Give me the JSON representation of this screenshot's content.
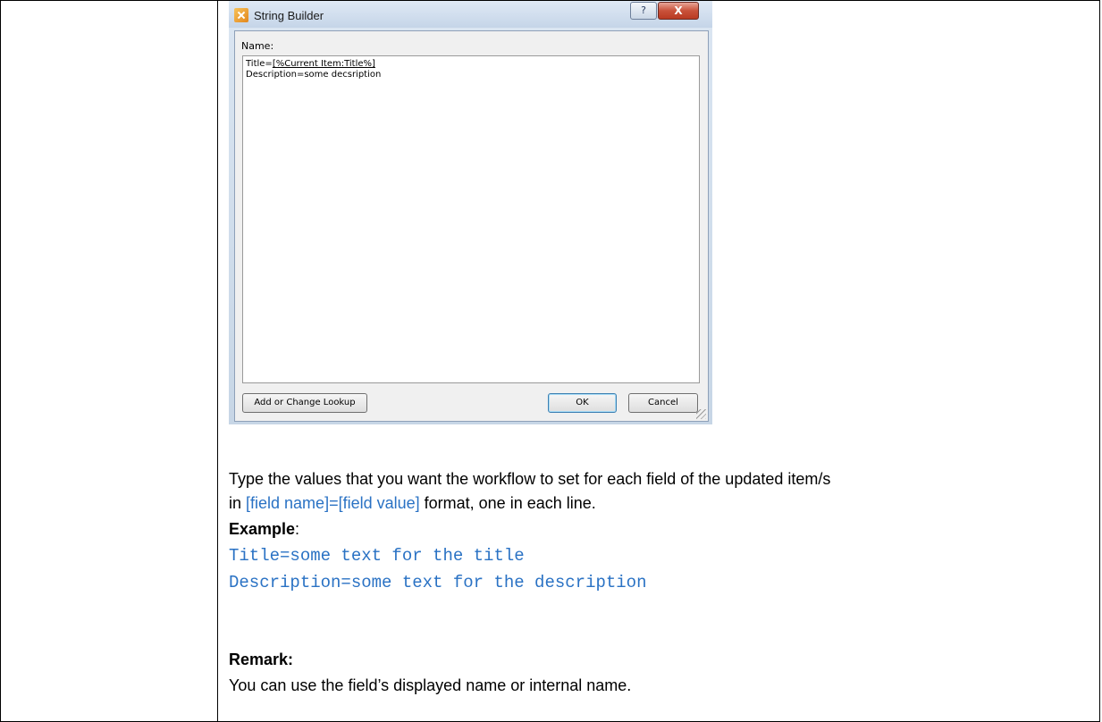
{
  "dialog": {
    "title": "String Builder",
    "help_glyph": "?",
    "close_glyph": "X",
    "name_label": "Name:",
    "editor_line1_prefix": "Title=",
    "editor_line1_lookup": "[%Current Item:Title%]",
    "editor_line2": "Description=some decsription",
    "add_lookup_label": "Add or Change Lookup",
    "ok_label": "OK",
    "cancel_label": "Cancel"
  },
  "body": {
    "para1": "Type the values that you want the workflow to set for each field of the updated item/s",
    "para2_prefix": "in ",
    "para2_format": "[field name]=[field value]",
    "para2_suffix": " format, one in each line.",
    "example_label": "Example",
    "example_colon": ":",
    "example_line1": "Title=some text for the title",
    "example_line2": "Description=some text for the description",
    "remark_label": "Remark:",
    "remark_text": "You can use the field’s displayed name or internal name."
  }
}
